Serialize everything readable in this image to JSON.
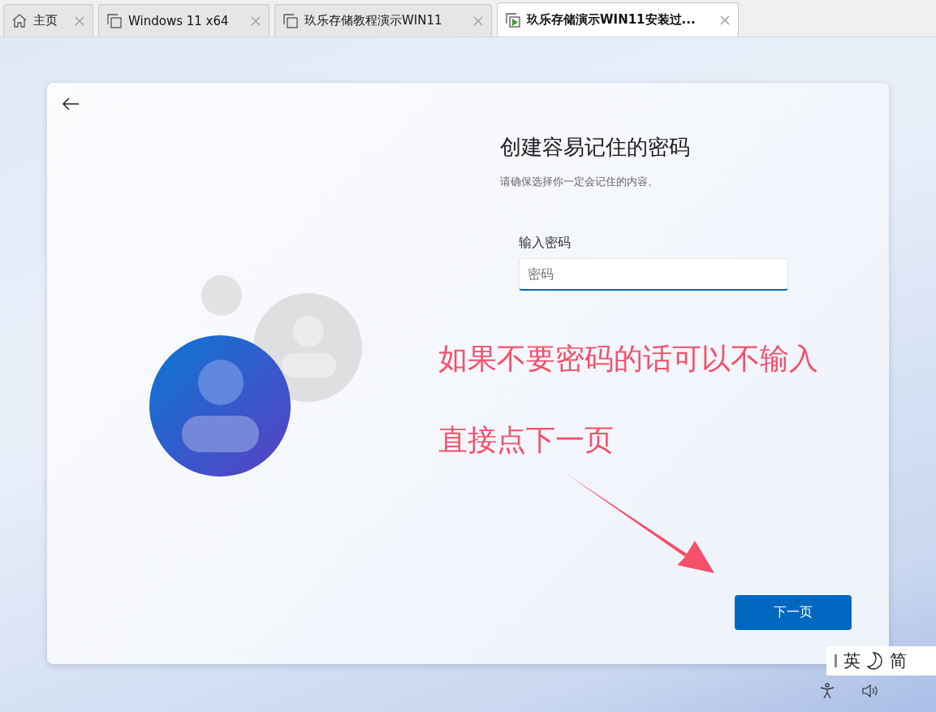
{
  "tabs": [
    {
      "label": "主页",
      "kind": "home",
      "selected": false
    },
    {
      "label": "Windows 11 x64",
      "kind": "vm",
      "selected": false
    },
    {
      "label": "玖乐存储教程演示WIN11",
      "kind": "vm",
      "selected": false
    },
    {
      "label": "玖乐存储演示WIN11安装过...",
      "kind": "vm-running",
      "selected": true
    }
  ],
  "setup": {
    "title": "创建容易记住的密码",
    "subtitle": "请确保选择你一定会记住的内容。",
    "field": {
      "label": "输入密码",
      "placeholder": "密码"
    },
    "next_button": "下一页"
  },
  "annotation": {
    "lines": [
      "如果不要密码的话可以不输入",
      "直接点下一页"
    ]
  },
  "ime": {
    "mode": "英",
    "script": "简"
  }
}
